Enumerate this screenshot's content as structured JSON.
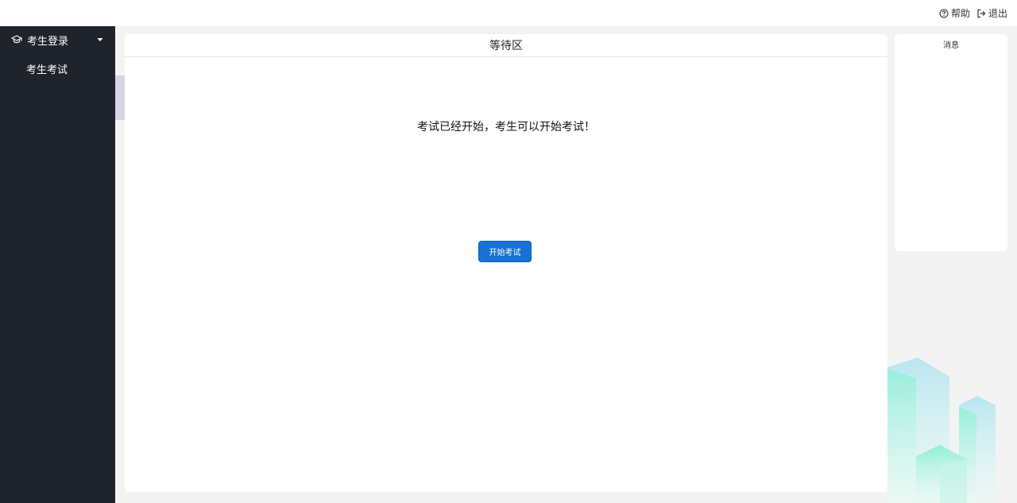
{
  "topbar": {
    "help_label": "帮助",
    "logout_label": "退出"
  },
  "sidebar": {
    "group_label": "考生登录",
    "items": [
      {
        "label": "考生考试"
      }
    ]
  },
  "main": {
    "title": "等待区",
    "notice": "考试已经开始，考生可以开始考试！",
    "start_button_label": "开始考试"
  },
  "messages": {
    "title": "消息"
  },
  "colors": {
    "sidebar_bg": "#1f232b",
    "primary_button": "#1772d4",
    "page_bg": "#f3f3f3"
  }
}
